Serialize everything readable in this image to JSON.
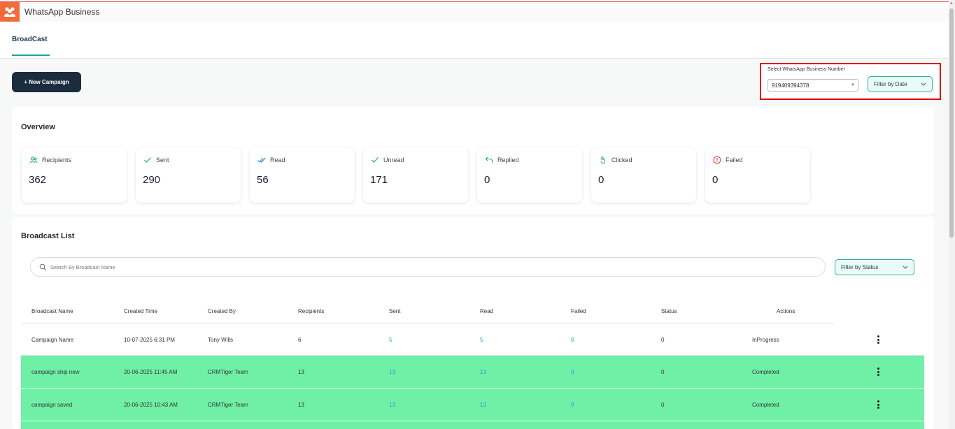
{
  "app": {
    "title": "WhatsApp Business"
  },
  "tabs": [
    {
      "label": "BroadCast"
    }
  ],
  "toolbar": {
    "new_campaign_label": "+ New Campaign",
    "business_number_label": "Select WhatsApp Business Number",
    "business_number_value": "919409394378",
    "filter_date_label": "Filter by Date"
  },
  "overview": {
    "title": "Overview",
    "stats": [
      {
        "label": "Recipients",
        "value": "362",
        "icon": "users-icon"
      },
      {
        "label": "Sent",
        "value": "290",
        "icon": "check-icon"
      },
      {
        "label": "Read",
        "value": "56",
        "icon": "double-check-icon"
      },
      {
        "label": "Unread",
        "value": "171",
        "icon": "check-icon"
      },
      {
        "label": "Replied",
        "value": "0",
        "icon": "reply-icon"
      },
      {
        "label": "Clicked",
        "value": "0",
        "icon": "pointer-icon"
      },
      {
        "label": "Failed",
        "value": "0",
        "icon": "alert-icon"
      }
    ]
  },
  "broadcast_list": {
    "title": "Broadcast List",
    "search_placeholder": "Search By Broadcast Name",
    "filter_status_label": "Filter by Status",
    "columns": [
      "Broadcast Name",
      "Created Time",
      "Created By",
      "Recipients",
      "Sent",
      "Read",
      "Failed",
      "Status",
      "Actions"
    ],
    "rows": [
      {
        "name": "Campaign Name",
        "created_time": "10-07-2025 6:31 PM",
        "created_by": "Tony Wills",
        "recipients": "6",
        "sent": "5",
        "read": "5",
        "failed": "0",
        "status_count": "0",
        "status": "InProgress",
        "highlight": false
      },
      {
        "name": "campaign ship new",
        "created_time": "20-06-2025 11:45 AM",
        "created_by": "CRMTiger Team",
        "recipients": "13",
        "sent": "13",
        "read": "13",
        "failed": "0",
        "status_count": "0",
        "status": "Completed",
        "highlight": true
      },
      {
        "name": "campaign saved",
        "created_time": "20-06-2025 10:43 AM",
        "created_by": "CRMTiger Team",
        "recipients": "13",
        "sent": "13",
        "read": "13",
        "failed": "9",
        "status_count": "0",
        "status": "Completed",
        "highlight": true
      }
    ]
  },
  "colors": {
    "accent": "#1aa58a",
    "dark_button": "#1b2c3e",
    "highlight_row": "#6ff0a6",
    "link": "#1e9fd8",
    "alert_box": "#e00000"
  }
}
